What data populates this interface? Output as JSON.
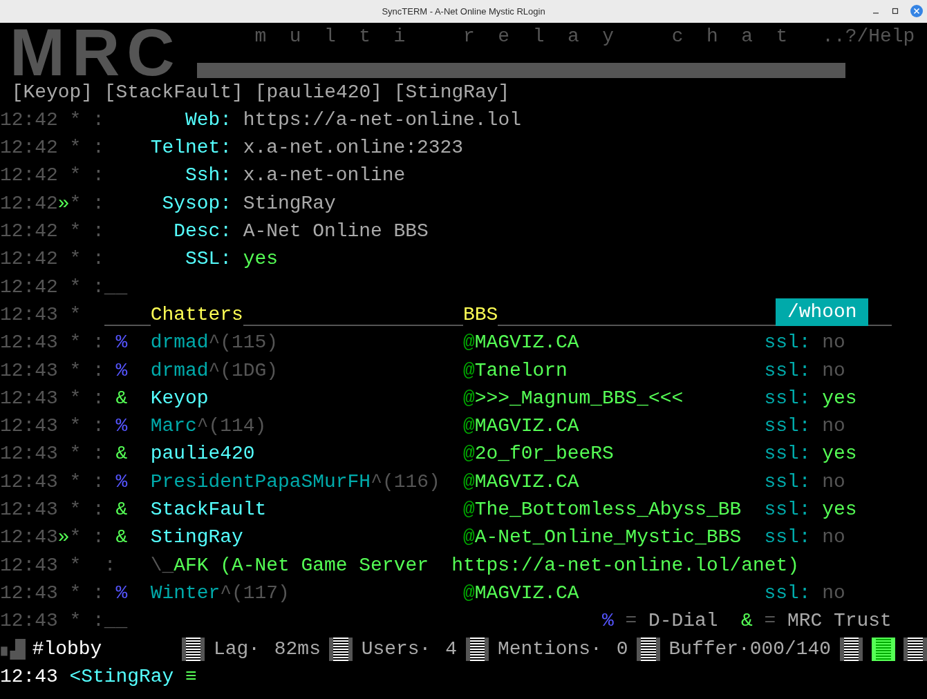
{
  "window": {
    "title": "SyncTERM - A-Net Online Mystic RLogin"
  },
  "header": {
    "logo": "MRC",
    "tagline": "multi relay chat",
    "help": "..?/Help"
  },
  "users": [
    "[Keyop]",
    "[StackFault]",
    "[paulie420]",
    "[StingRay]"
  ],
  "rows": [
    {
      "kind": "info",
      "time": "12:42",
      "star": "*",
      "colon": ":",
      "label": "Web:",
      "value": "https://a-net-online.lol"
    },
    {
      "kind": "info",
      "time": "12:42",
      "star": "*",
      "colon": ":",
      "label": "Telnet:",
      "value": "x.a-net.online:2323"
    },
    {
      "kind": "info",
      "time": "12:42",
      "star": "*",
      "colon": ":",
      "label": "Ssh:",
      "value": "x.a-net-online"
    },
    {
      "kind": "info",
      "time": "12:42",
      "marker": "»",
      "star": "*",
      "colon": ":",
      "label": "Sysop:",
      "value": "StingRay"
    },
    {
      "kind": "info",
      "time": "12:42",
      "star": "*",
      "colon": ":",
      "label": "Desc:",
      "value": "A-Net Online BBS"
    },
    {
      "kind": "info",
      "time": "12:42",
      "star": "*",
      "colon": ":",
      "label": "SSL:",
      "value": "yes",
      "secure": true
    },
    {
      "kind": "blank",
      "time": "12:42",
      "star": "*",
      "colon": ":",
      "cursor": "__"
    },
    {
      "kind": "header",
      "time": "12:43",
      "star": "*",
      "chatters": "Chatters",
      "bbs": "BBS",
      "command": "/whoon"
    },
    {
      "kind": "chatter",
      "time": "12:43",
      "star": "*",
      "colon": ":",
      "trust": false,
      "prefix": "%",
      "nick": "drmad",
      "suffix": "^(115)",
      "bbs": "@MAGVIZ.CA",
      "ssl_label": "ssl:",
      "ssl": "no",
      "secure": false
    },
    {
      "kind": "chatter",
      "time": "12:43",
      "star": "*",
      "colon": ":",
      "trust": false,
      "prefix": "%",
      "nick": "drmad",
      "suffix": "^(1DG)",
      "bbs": "@Tanelorn",
      "ssl_label": "ssl:",
      "ssl": "no",
      "secure": false
    },
    {
      "kind": "chatter",
      "time": "12:43",
      "star": "*",
      "colon": ":",
      "trust": true,
      "prefix": "&",
      "nick": "Keyop",
      "bbs": "@>>>_Magnum_BBS_<<<",
      "ssl_label": "ssl:",
      "ssl": "yes",
      "secure": true
    },
    {
      "kind": "chatter",
      "time": "12:43",
      "star": "*",
      "colon": ":",
      "trust": false,
      "prefix": "%",
      "nick": "Marc",
      "suffix": "^(114)",
      "bbs": "@MAGVIZ.CA",
      "ssl_label": "ssl:",
      "ssl": "no",
      "secure": false
    },
    {
      "kind": "chatter",
      "time": "12:43",
      "star": "*",
      "colon": ":",
      "trust": true,
      "prefix": "&",
      "nick": "paulie420",
      "bbs": "@2o_f0r_beeRS",
      "ssl_label": "ssl:",
      "ssl": "yes",
      "secure": true
    },
    {
      "kind": "chatter",
      "time": "12:43",
      "star": "*",
      "colon": ":",
      "trust": false,
      "prefix": "%",
      "nick": "PresidentPapaSMurFH",
      "suffix": "^(116)",
      "bbs": "@MAGVIZ.CA",
      "ssl_label": "ssl:",
      "ssl": "no",
      "secure": false
    },
    {
      "kind": "chatter",
      "time": "12:43",
      "star": "*",
      "colon": ":",
      "trust": true,
      "prefix": "&",
      "nick": "StackFault",
      "bbs": "@The_Bottomless_Abyss_BB",
      "ssl_label": "ssl:",
      "ssl": "yes",
      "secure": true
    },
    {
      "kind": "chatter",
      "time": "12:43",
      "marker": "»",
      "star": "*",
      "colon": ":",
      "trust": true,
      "prefix": "&",
      "nick": "StingRay",
      "bbs": "@A-Net_Online_Mystic_BBS",
      "ssl_label": "ssl:",
      "ssl": "no",
      "secure": false
    },
    {
      "kind": "afk",
      "time": "12:43",
      "star": "*",
      "colon": ":",
      "text": "\\_AFK (A-Net Game Server",
      "url": "https://a-net-online.lol/anet)"
    },
    {
      "kind": "chatter",
      "time": "12:43",
      "star": "*",
      "colon": ":",
      "trust": false,
      "prefix": "%",
      "nick": "Winter",
      "suffix": "^(117)",
      "bbs": "@MAGVIZ.CA",
      "ssl_label": "ssl:",
      "ssl": "no",
      "secure": false
    },
    {
      "kind": "legend",
      "time": "12:43",
      "star": "*",
      "colon": ":",
      "cursor": "__",
      "items": [
        {
          "symbol": "%",
          "equals": "=",
          "label": "D-Dial",
          "trust": false
        },
        {
          "symbol": "&",
          "equals": "=",
          "label": "MRC Trust",
          "trust": true
        }
      ]
    }
  ],
  "status_bar": {
    "channel": "#lobby",
    "stats": [
      {
        "label": "Lag·",
        "value": "82ms"
      },
      {
        "label": "Users·",
        "value": "4"
      },
      {
        "label": "Mentions·",
        "value": "0"
      },
      {
        "label": "Buffer·000/140"
      }
    ],
    "indicators": [
      {
        "on": false
      },
      {
        "on": true
      },
      {
        "on": false
      }
    ]
  },
  "input": {
    "time": "12:43",
    "prompt": "<StingRay",
    "menu": "≡"
  }
}
